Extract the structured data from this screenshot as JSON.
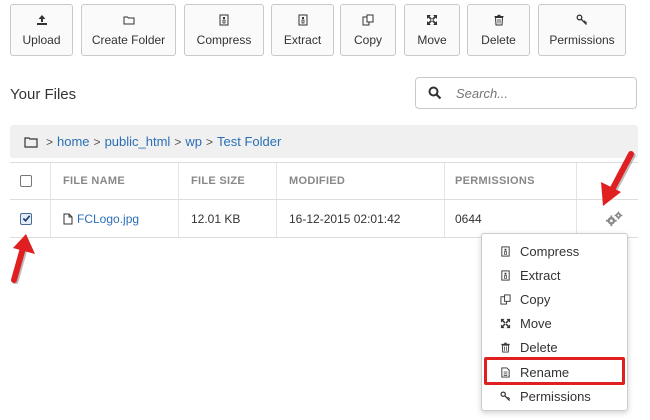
{
  "toolbar": {
    "buttons": [
      {
        "label": "Upload",
        "icon": "upload-icon"
      },
      {
        "label": "Create Folder",
        "icon": "folder-icon"
      },
      {
        "label": "Compress",
        "icon": "compress-icon"
      },
      {
        "label": "Extract",
        "icon": "extract-icon"
      },
      {
        "label": "Copy",
        "icon": "copy-icon"
      },
      {
        "label": "Move",
        "icon": "move-icon"
      },
      {
        "label": "Delete",
        "icon": "trash-icon"
      },
      {
        "label": "Permissions",
        "icon": "key-icon"
      }
    ]
  },
  "section_title": "Your Files",
  "search": {
    "placeholder": "Search...",
    "value": ""
  },
  "breadcrumb": {
    "items": [
      "home",
      "public_html",
      "wp",
      "Test Folder"
    ],
    "separator": ">"
  },
  "table": {
    "headers": [
      "FILE NAME",
      "FILE SIZE",
      "MODIFIED",
      "PERMISSIONS"
    ],
    "rows": [
      {
        "name": "FCLogo.jpg",
        "size": "12.01 KB",
        "modified": "16-12-2015 02:01:42",
        "permissions": "0644",
        "checked": true
      }
    ]
  },
  "context_menu": {
    "items": [
      {
        "label": "Compress",
        "icon": "compress-icon"
      },
      {
        "label": "Extract",
        "icon": "extract-icon"
      },
      {
        "label": "Copy",
        "icon": "copy-icon"
      },
      {
        "label": "Move",
        "icon": "move-icon"
      },
      {
        "label": "Delete",
        "icon": "trash-icon"
      },
      {
        "label": "Rename",
        "icon": "file-icon"
      },
      {
        "label": "Permissions",
        "icon": "key-icon"
      }
    ],
    "highlighted": "Rename"
  },
  "colors": {
    "link": "#2a6fb5",
    "annotation_red": "#e02020",
    "breadcrumb_bg": "#f0f0f0"
  }
}
